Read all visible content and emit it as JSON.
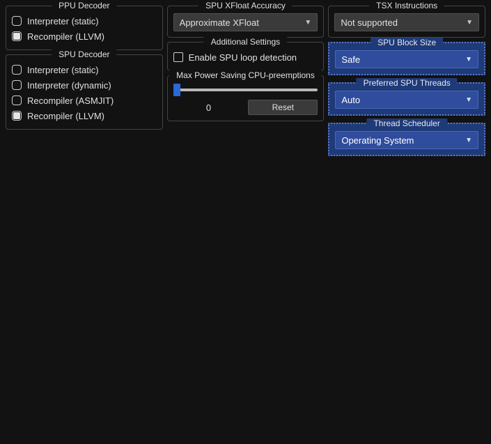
{
  "ppu_decoder": {
    "title": "PPU Decoder",
    "options": [
      {
        "label": "Interpreter (static)",
        "selected": false
      },
      {
        "label": "Recompiler (LLVM)",
        "selected": true
      }
    ]
  },
  "spu_decoder": {
    "title": "SPU Decoder",
    "options": [
      {
        "label": "Interpreter (static)",
        "selected": false
      },
      {
        "label": "Interpreter (dynamic)",
        "selected": false
      },
      {
        "label": "Recompiler (ASMJIT)",
        "selected": false
      },
      {
        "label": "Recompiler (LLVM)",
        "selected": true
      }
    ]
  },
  "xfloat": {
    "title": "SPU XFloat Accuracy",
    "value": "Approximate XFloat"
  },
  "additional": {
    "title": "Additional Settings",
    "loop_detection_label": "Enable SPU loop detection",
    "loop_detection_checked": false
  },
  "preemptions": {
    "title": "Max Power Saving CPU-preemptions",
    "value": "0",
    "reset_label": "Reset"
  },
  "tsx": {
    "title": "TSX Instructions",
    "value": "Not supported"
  },
  "block_size": {
    "title": "SPU Block Size",
    "value": "Safe"
  },
  "spu_threads": {
    "title": "Preferred SPU Threads",
    "value": "Auto"
  },
  "scheduler": {
    "title": "Thread Scheduler",
    "value": "Operating System"
  }
}
